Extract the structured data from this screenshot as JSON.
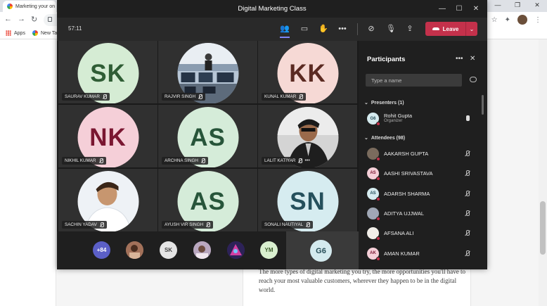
{
  "browser": {
    "tab_title": "Marketing your on",
    "bookmarks": [
      "Apps",
      "New Ta"
    ],
    "window_controls": [
      "—",
      "❐",
      "✕"
    ]
  },
  "page": {
    "paragraph": "The more types of digital marketing you try, the more opportunities you'll have to reach your most valuable customers, wherever they happen to be in the digital world."
  },
  "teams": {
    "window_title": "Digital Marketing Class",
    "window_controls": [
      "—",
      "☐",
      "✕"
    ],
    "timer": "57:11",
    "leave_label": "Leave",
    "tiles": [
      {
        "initials": "SK",
        "name": "SAURAV KUMAR",
        "bg": "#d5ecd4",
        "fg": "#2f5d35",
        "photo": false
      },
      {
        "initials": "",
        "name": "RAJVIR SINGH",
        "bg": "#9fb3c8",
        "fg": "#000",
        "photo": true
      },
      {
        "initials": "KK",
        "name": "KUNAL KUMAR",
        "bg": "#f6d9d5",
        "fg": "#5b2a22",
        "photo": false
      },
      {
        "initials": "NK",
        "name": "NIKHIL KUMAR",
        "bg": "#f5cfd8",
        "fg": "#7a1631",
        "photo": false
      },
      {
        "initials": "AS",
        "name": "ARCHNA SINGH",
        "bg": "#d5ecd9",
        "fg": "#27553a",
        "photo": false
      },
      {
        "initials": "",
        "name": "LALIT KATIYAR",
        "bg": "#c7c7c7",
        "fg": "#000",
        "photo": true
      },
      {
        "initials": "",
        "name": "SACHIN YADAV",
        "bg": "#e8eef4",
        "fg": "#000",
        "photo": true
      },
      {
        "initials": "AS",
        "name": "AYUSH VIR SINGH",
        "bg": "#d5ecd9",
        "fg": "#27553a",
        "photo": false
      },
      {
        "initials": "SN",
        "name": "SONALI NAUTIYAL",
        "bg": "#d6ecf0",
        "fg": "#25505c",
        "photo": false
      }
    ],
    "strip": {
      "overflow_count": "+84",
      "mini_avatars": [
        {
          "label": "",
          "bg": "#8b5e4a",
          "photo": true
        },
        {
          "label": "SK",
          "bg": "#e4e4e4",
          "fg": "#444"
        },
        {
          "label": "",
          "bg": "#9b8ea3",
          "photo": true
        },
        {
          "label": "",
          "bg": "#3a2d6b",
          "photo": true
        },
        {
          "label": "YM",
          "bg": "#d9efcf",
          "fg": "#3a5a2a"
        }
      ],
      "self_initials": "G6"
    }
  },
  "participants": {
    "title": "Participants",
    "search_placeholder": "Type a name",
    "presenters_label": "Presenters (1)",
    "attendees_label": "Attendees (98)",
    "presenters": [
      {
        "initials": "G6",
        "name": "Rohit Gupta",
        "role": "Organizer",
        "bg": "#d4eaee",
        "fg": "#264d57",
        "mic": "on"
      }
    ],
    "attendees": [
      {
        "initials": "",
        "name": "AAKARSH GUPTA",
        "bg": "#7a6b5d",
        "fg": "#fff",
        "mic": "off"
      },
      {
        "initials": "AS",
        "name": "AASHI SRIVASTAVA",
        "bg": "#f5cfd8",
        "fg": "#7a1631",
        "mic": "off"
      },
      {
        "initials": "AS",
        "name": "ADARSH SHARMA",
        "bg": "#d6ecf0",
        "fg": "#25505c",
        "mic": "off"
      },
      {
        "initials": "",
        "name": "ADITYA UJJWAL",
        "bg": "#a0a7b5",
        "fg": "#fff",
        "mic": "off"
      },
      {
        "initials": "",
        "name": "AFSANA ALI",
        "bg": "#f2efe9",
        "fg": "#333",
        "mic": "off"
      },
      {
        "initials": "AK",
        "name": "AMAN KUMAR",
        "bg": "#f5cfd8",
        "fg": "#7a1631",
        "mic": "off"
      }
    ]
  }
}
